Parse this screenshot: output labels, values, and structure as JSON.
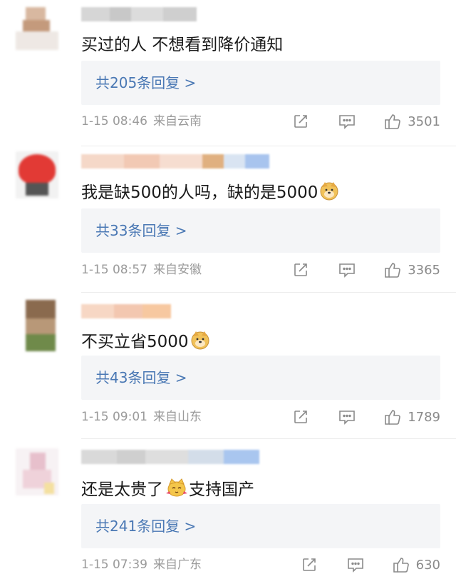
{
  "comments": [
    {
      "text": "买过的人 不想看到降价通知",
      "reply_label": "共205条回复 >",
      "time": "1-15 08:46",
      "location": "来自云南",
      "likes": "3501",
      "emoji": null
    },
    {
      "text": "我是缺500的人吗，缺的是5000",
      "reply_label": "共33条回复 >",
      "time": "1-15 08:57",
      "location": "来自安徽",
      "likes": "3365",
      "emoji": "doge-emoji"
    },
    {
      "text": "不买立省5000",
      "reply_label": "共43条回复 >",
      "time": "1-15 09:01",
      "location": "来自山东",
      "likes": "1789",
      "emoji": "doge-emoji"
    },
    {
      "text_before": "还是太贵了",
      "text_after": "支持国产",
      "reply_label": "共241条回复 >",
      "time": "1-15 07:39",
      "location": "来自广东",
      "likes": "630",
      "emoji": "cat-emoji"
    }
  ],
  "icons": {
    "share": "share-icon",
    "reply": "comment-icon",
    "like": "thumbs-up-icon"
  },
  "colors": {
    "link": "#4a78b4",
    "meta": "#9a9a9a",
    "reply_bg": "#f4f5f7"
  }
}
